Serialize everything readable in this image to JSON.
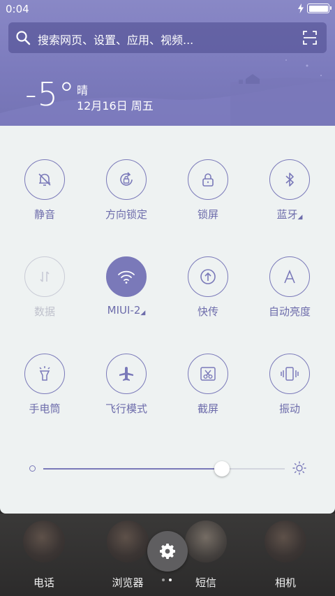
{
  "status_bar": {
    "time": "0:04",
    "icons": [
      "charging-icon",
      "battery-icon"
    ]
  },
  "search": {
    "placeholder": "搜索网页、设置、应用、视频...",
    "icons": [
      "search-icon",
      "scan-icon"
    ]
  },
  "weather": {
    "temperature": "-5°",
    "condition": "晴",
    "date": "12月16日 周五"
  },
  "toggles": [
    {
      "id": "mute",
      "label": "静音",
      "icon": "bell-off-icon",
      "state": "off"
    },
    {
      "id": "rotation-lock",
      "label": "方向锁定",
      "icon": "rotation-lock-icon",
      "state": "off"
    },
    {
      "id": "lock-screen",
      "label": "锁屏",
      "icon": "lock-icon",
      "state": "off"
    },
    {
      "id": "bluetooth",
      "label": "蓝牙",
      "icon": "bluetooth-icon",
      "state": "off",
      "has_menu": true
    },
    {
      "id": "data",
      "label": "数据",
      "icon": "data-arrows-icon",
      "state": "disabled"
    },
    {
      "id": "wifi",
      "label": "MIUI-2",
      "icon": "wifi-icon",
      "state": "on",
      "has_menu": true
    },
    {
      "id": "quick-send",
      "label": "快传",
      "icon": "upload-icon",
      "state": "off"
    },
    {
      "id": "auto-brightness",
      "label": "自动亮度",
      "icon": "letter-a-icon",
      "state": "off"
    },
    {
      "id": "flashlight",
      "label": "手电筒",
      "icon": "flashlight-icon",
      "state": "off"
    },
    {
      "id": "airplane",
      "label": "飞行模式",
      "icon": "airplane-icon",
      "state": "off"
    },
    {
      "id": "screenshot",
      "label": "截屏",
      "icon": "scissors-icon",
      "state": "off"
    },
    {
      "id": "vibrate",
      "label": "振动",
      "icon": "vibrate-icon",
      "state": "off"
    }
  ],
  "brightness": {
    "level": 0.74
  },
  "dock": [
    {
      "label": "电话",
      "icon": "phone-app-icon"
    },
    {
      "label": "浏览器",
      "icon": "browser-app-icon"
    },
    {
      "label": "短信",
      "icon": "messages-app-icon"
    },
    {
      "label": "相机",
      "icon": "camera-app-icon"
    }
  ],
  "page_indicator": {
    "count": 2,
    "active": 1
  },
  "colors": {
    "accent": "#7a79b9",
    "panel_bg": "#eef2f2",
    "header_bg": "#7c7bbd",
    "label": "#6d6cab",
    "disabled": "#c9cbd6"
  }
}
